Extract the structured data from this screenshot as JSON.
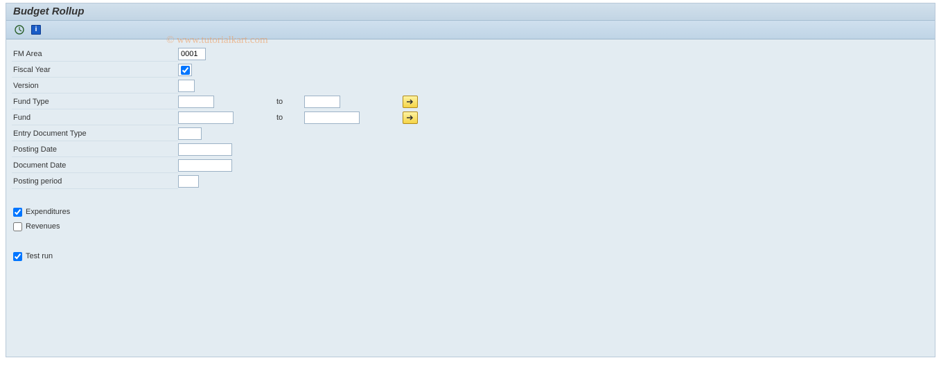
{
  "titlebar": {
    "text": "Budget Rollup"
  },
  "toolbar": {
    "execute_tooltip": "Execute",
    "info_tooltip": "Information"
  },
  "form": {
    "fm_area": {
      "label": "FM Area",
      "value": "0001"
    },
    "fiscal_year": {
      "label": "Fiscal Year",
      "checked": true
    },
    "version": {
      "label": "Version",
      "value": ""
    },
    "fund_type": {
      "label": "Fund Type",
      "from": "",
      "to_label": "to",
      "to": ""
    },
    "fund": {
      "label": "Fund",
      "from": "",
      "to_label": "to",
      "to": ""
    },
    "entry_doc_type": {
      "label": "Entry Document Type",
      "value": ""
    },
    "posting_date": {
      "label": "Posting Date",
      "value": ""
    },
    "document_date": {
      "label": "Document Date",
      "value": ""
    },
    "posting_period": {
      "label": "Posting period",
      "value": ""
    }
  },
  "checks": {
    "expenditures": {
      "label": "Expenditures",
      "checked": true
    },
    "revenues": {
      "label": "Revenues",
      "checked": false
    },
    "test_run": {
      "label": "Test run",
      "checked": true
    }
  },
  "watermark": "© www.tutorialkart.com"
}
